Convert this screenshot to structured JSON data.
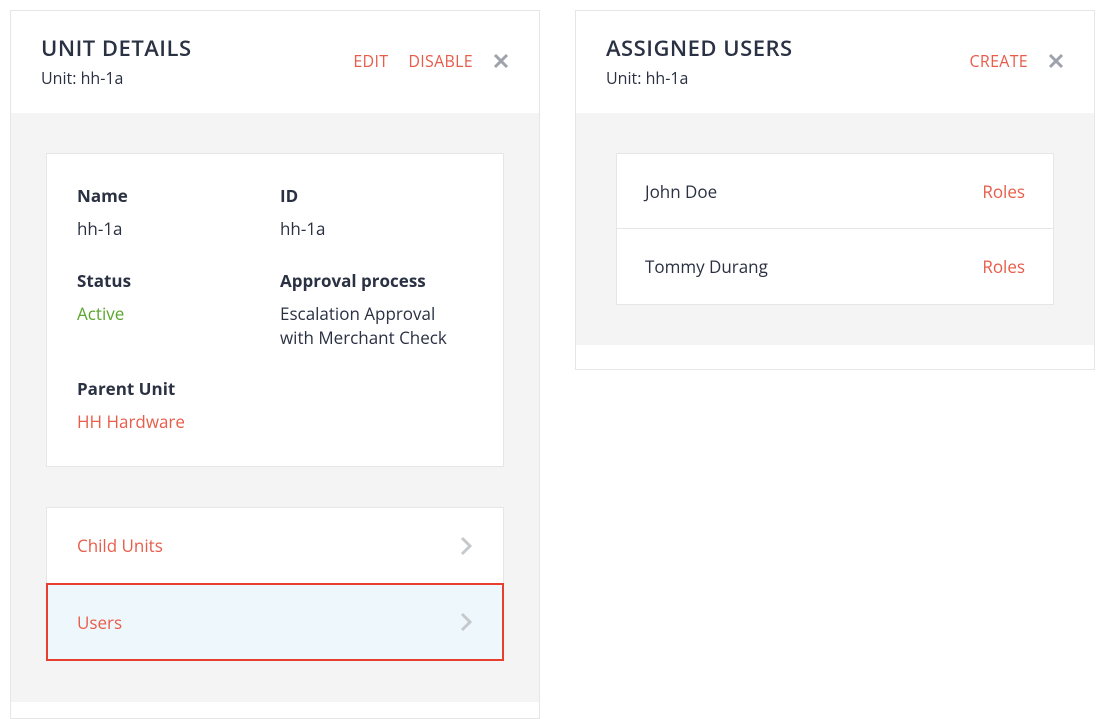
{
  "left": {
    "title": "UNIT DETAILS",
    "unit_label": "Unit: hh-1a",
    "actions": {
      "edit": "EDIT",
      "disable": "DISABLE"
    },
    "fields": {
      "name_label": "Name",
      "name_value": "hh-1a",
      "id_label": "ID",
      "id_value": "hh-1a",
      "status_label": "Status",
      "status_value": "Active",
      "approval_label": "Approval process",
      "approval_value": "Escalation Approval with Merchant Check",
      "parent_label": "Parent Unit",
      "parent_value": "HH Hardware"
    },
    "nav": {
      "child_units": "Child Units",
      "users": "Users"
    }
  },
  "right": {
    "title": "ASSIGNED USERS",
    "unit_label": "Unit: hh-1a",
    "actions": {
      "create": "CREATE"
    },
    "users": [
      {
        "name": "John Doe",
        "roles_link": "Roles"
      },
      {
        "name": "Tommy Durang",
        "roles_link": "Roles"
      }
    ]
  }
}
